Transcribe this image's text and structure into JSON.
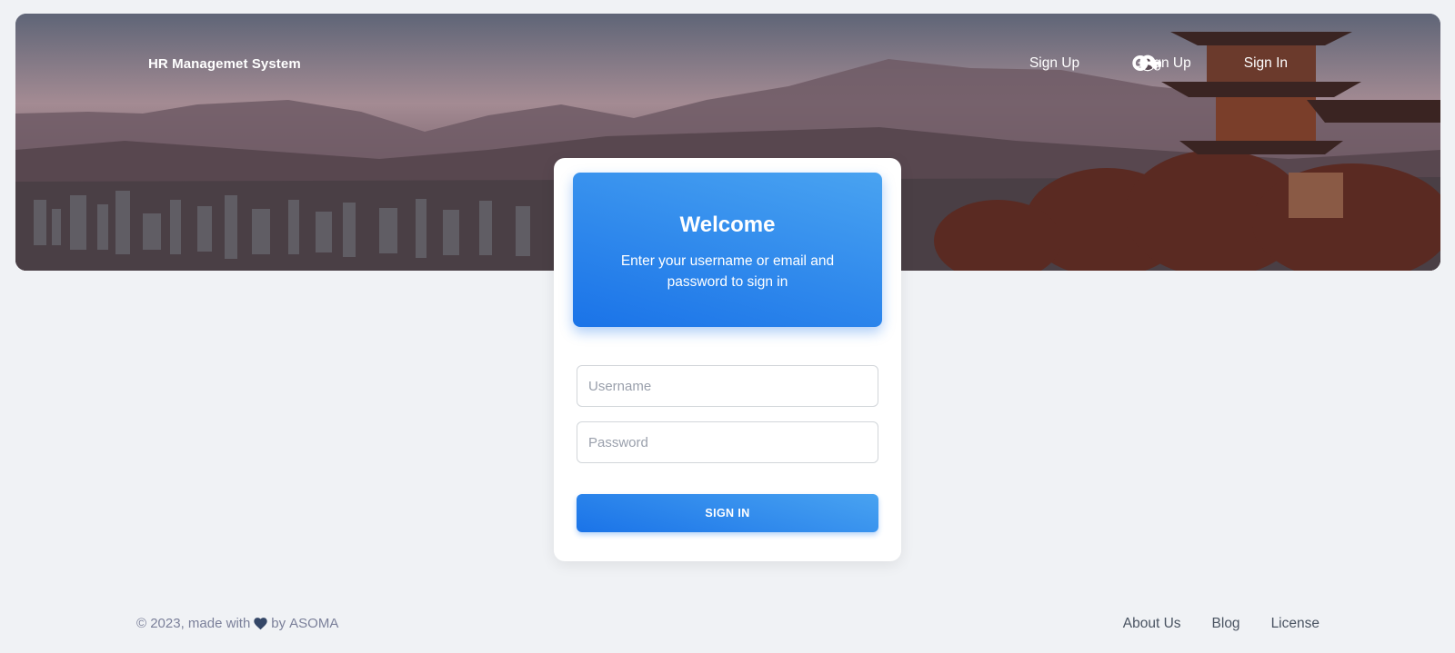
{
  "navbar": {
    "brand": "HR Managemet System",
    "items": [
      {
        "label": "Sign Up",
        "icon": "account-circle-icon"
      },
      {
        "label": "Gsign Up",
        "icon": "account-circle-icon"
      },
      {
        "label": "Sign In",
        "icon": "key-icon"
      }
    ]
  },
  "card": {
    "title": "Welcome",
    "subtitle": "Enter your username or email and password to sign in",
    "username_placeholder": "Username",
    "password_placeholder": "Password",
    "signin_label": "SIGN IN"
  },
  "footer": {
    "copyright": "© 2023, made with",
    "by": "by",
    "author": "ASOMA",
    "links": [
      "About Us",
      "Blog",
      "License"
    ]
  },
  "colors": {
    "primary": "#1A73E8",
    "primary_light": "#49a3f1",
    "background": "#f0f2f5",
    "text_dark": "#344767"
  }
}
